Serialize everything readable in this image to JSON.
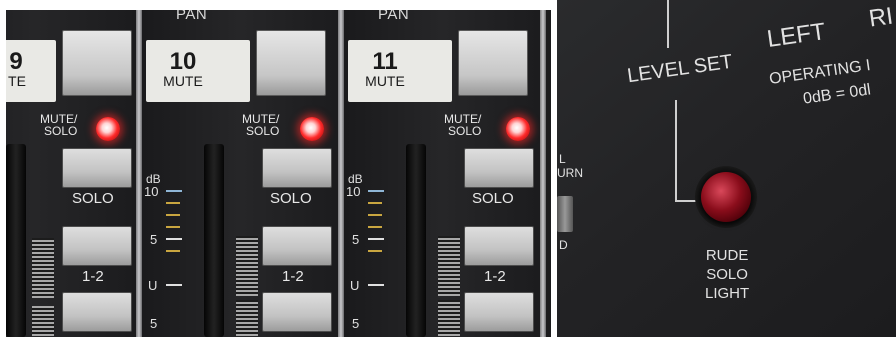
{
  "mixer": {
    "channels": [
      {
        "number": "9",
        "mute": "MUTE"
      },
      {
        "number": "10",
        "mute": "MUTE"
      },
      {
        "number": "11",
        "mute": "MUTE"
      }
    ],
    "pan_label": "PAN",
    "mute_solo_label_line1": "MUTE/",
    "mute_solo_label_line2": "SOLO",
    "solo_label": "SOLO",
    "bus_label": "1-2",
    "db_label": "dB",
    "db_10": "10",
    "db_5": "5",
    "db_u": "U",
    "db_5b": "5"
  },
  "panel": {
    "level_set": "LEVEL SET",
    "left": "LEFT",
    "right_partial": "RI",
    "operating": "OPERATING I",
    "odb": "0dB = 0dl",
    "side_top": "L",
    "side_mid": "URN",
    "side_bottom": "D",
    "rude_line1": "RUDE",
    "rude_line2": "SOLO",
    "rude_line3": "LIGHT"
  },
  "colors": {
    "mixer_body": "#1b1b1d",
    "led_red": "#ff2a2a",
    "tick_yellow": "#c9a640",
    "tick_blue": "#8fb6d6"
  }
}
